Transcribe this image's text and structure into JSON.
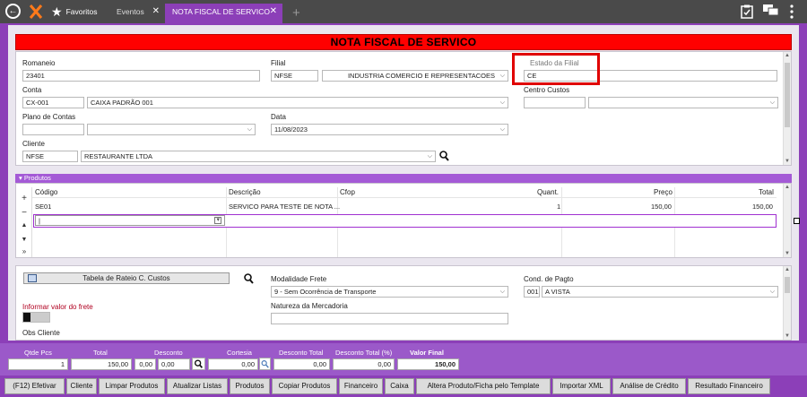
{
  "titlebar": {
    "favorites_label": "Favoritos",
    "tabs": [
      {
        "label": "Eventos"
      },
      {
        "label": "NOTA FISCAL DE SERVICO"
      }
    ],
    "close_glyph": "✕",
    "add_glyph": "+",
    "icons": [
      "back-icon",
      "logo-icon",
      "star-icon",
      "clipboard-icon",
      "chat-icon",
      "more-vert-icon"
    ]
  },
  "form": {
    "title": "NOTA FISCAL DE SERVICO",
    "romaneio": {
      "label": "Romaneio",
      "value": "23401"
    },
    "filial": {
      "label": "Filial",
      "code": "NFSE",
      "name": "INDUSTRIA COMERCIO E REPRESENTACOES"
    },
    "estado_filial": {
      "label": "Estado da Filial",
      "value": "CE"
    },
    "conta": {
      "label": "Conta",
      "code": "CX-001",
      "name": "CAIXA PADRÃO 001"
    },
    "centro_custos": {
      "label": "Centro Custos",
      "code": "",
      "name": ""
    },
    "plano_contas": {
      "label": "Plano de Contas",
      "code": "",
      "name": ""
    },
    "data": {
      "label": "Data",
      "value": "11/08/2023"
    },
    "cliente": {
      "label": "Cliente",
      "code": "NFSE",
      "name": "RESTAURANTE LTDA"
    }
  },
  "produtos": {
    "section_label": "Produtos",
    "columns": [
      "Código",
      "Descrição",
      "Cfop",
      "Quant.",
      "Preço",
      "Total"
    ],
    "rows": [
      {
        "codigo": "SE01",
        "descricao": "SERVICO PARA TESTE DE NOTA ...",
        "cfop": "",
        "quant": "1",
        "preco": "150,00",
        "total": "150,00"
      }
    ],
    "new_row_value": "|"
  },
  "lower": {
    "rateio_label": "Tabela de Rateio C. Custos",
    "modalidade_frete": {
      "label": "Modalidade Frete",
      "value": "9 - Sem Ocorrência de Transporte"
    },
    "cond_pagto": {
      "label": "Cond. de Pagto",
      "code": "001",
      "name": "A VISTA"
    },
    "informar_frete_label": "Informar valor do frete",
    "natureza_label": "Natureza da Mercadoria",
    "natureza_value": "",
    "obs_cliente_label": "Obs Cliente"
  },
  "totals": {
    "qtde_pcs": {
      "label": "Qtde Pcs",
      "value": "1"
    },
    "total": {
      "label": "Total",
      "value": "150,00"
    },
    "desconto": {
      "label": "Desconto",
      "pct": "0,00",
      "value": "0,00"
    },
    "cortesia": {
      "label": "Cortesia",
      "value": "0,00"
    },
    "desconto_total": {
      "label": "Desconto Total",
      "value": "0,00"
    },
    "desconto_total_pct": {
      "label": "Desconto Total (%)",
      "value": "0,00"
    },
    "valor_final": {
      "label": "Valor Final",
      "value": "150,00"
    }
  },
  "buttons": [
    "(F12) Efetivar",
    "Cliente",
    "Limpar Produtos",
    "Atualizar Listas",
    "Produtos",
    "Copiar Produtos",
    "Financeiro",
    "Caixa",
    "Altera Produto/Ficha pelo Template",
    "Importar XML",
    "Análise de Crédito",
    "Resultado Financeiro"
  ],
  "colors": {
    "header_red": "#ff0000",
    "accent_purple": "#8c3fb8",
    "highlight_box": "#e00000"
  }
}
